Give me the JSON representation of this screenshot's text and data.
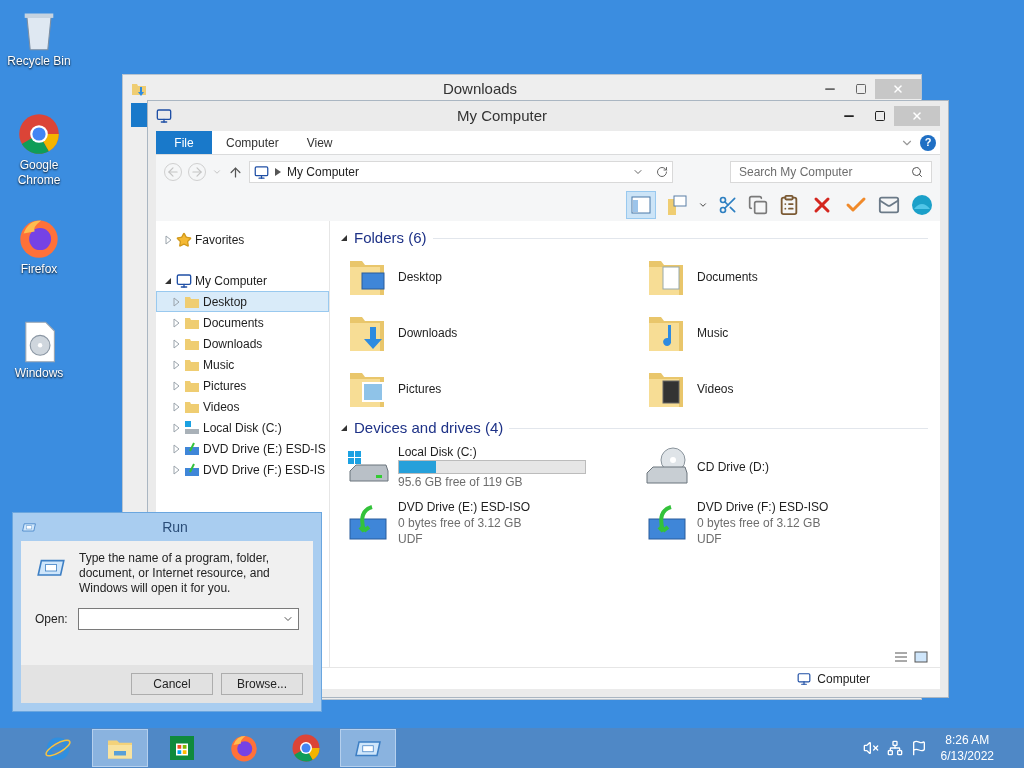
{
  "desktop_icons": [
    {
      "label": "Recycle Bin",
      "kind": "recycle"
    },
    {
      "label": "Google Chrome",
      "kind": "chrome"
    },
    {
      "label": "Firefox",
      "kind": "firefox"
    },
    {
      "label": "Windows",
      "kind": "disc"
    }
  ],
  "back_window": {
    "title": "Downloads"
  },
  "explorer": {
    "title": "My Computer",
    "ribbon_tabs": [
      {
        "label": "File",
        "selected": true
      },
      {
        "label": "Computer",
        "selected": false
      },
      {
        "label": "View",
        "selected": false
      }
    ],
    "address": {
      "path": "My Computer"
    },
    "search": {
      "placeholder": "Search My Computer"
    },
    "nav": [
      {
        "label": "Favorites",
        "kind": "star",
        "expanded": false,
        "selected": false
      },
      {
        "label": "My Computer",
        "kind": "computer",
        "expanded": true,
        "selected": false,
        "children": [
          {
            "label": "Desktop",
            "kind": "folder",
            "expanded": false,
            "selected": true
          },
          {
            "label": "Documents",
            "kind": "folder",
            "expanded": false,
            "selected": false
          },
          {
            "label": "Downloads",
            "kind": "folder",
            "expanded": false,
            "selected": false
          },
          {
            "label": "Music",
            "kind": "folder",
            "expanded": false,
            "selected": false
          },
          {
            "label": "Pictures",
            "kind": "folder",
            "expanded": false,
            "selected": false
          },
          {
            "label": "Videos",
            "kind": "folder",
            "expanded": false,
            "selected": false
          },
          {
            "label": "Local Disk (C:)",
            "kind": "disk",
            "expanded": false,
            "selected": false
          },
          {
            "label": "DVD Drive (E:) ESD-IS",
            "kind": "dvd",
            "expanded": false,
            "selected": false
          },
          {
            "label": "DVD Drive (F:) ESD-IS",
            "kind": "dvd",
            "expanded": false,
            "selected": false
          }
        ]
      }
    ],
    "sections": [
      {
        "title": "Folders (6)",
        "expanded": true,
        "items": [
          {
            "kind": "desktop",
            "name": "Desktop"
          },
          {
            "kind": "documents",
            "name": "Documents"
          },
          {
            "kind": "downloads",
            "name": "Downloads"
          },
          {
            "kind": "music",
            "name": "Music"
          },
          {
            "kind": "pictures",
            "name": "Pictures"
          },
          {
            "kind": "videos",
            "name": "Videos"
          }
        ]
      },
      {
        "title": "Devices and drives (4)",
        "expanded": true,
        "items": [
          {
            "kind": "disk",
            "name": "Local Disk (C:)",
            "level": 0.2,
            "free": "95.6 GB free of 119 GB"
          },
          {
            "kind": "cd",
            "name": "CD Drive (D:)"
          },
          {
            "kind": "dvd",
            "name": "DVD Drive (E:) ESD-ISO",
            "free": "0 bytes free of 3.12 GB",
            "fs": "UDF"
          },
          {
            "kind": "dvd",
            "name": "DVD Drive (F:) ESD-ISO",
            "free": "0 bytes free of 3.12 GB",
            "fs": "UDF"
          }
        ]
      }
    ],
    "help": "?",
    "status": {
      "location": "Computer"
    }
  },
  "run": {
    "title": "Run",
    "description": "Type the name of a program, folder, document, or Internet resource, and Windows will open it for you.",
    "label": "Open:",
    "buttons": [
      "Cancel",
      "Browse..."
    ]
  },
  "taskbar": {
    "apps": [
      {
        "kind": "ie",
        "active": false
      },
      {
        "kind": "explorer",
        "active": true
      },
      {
        "kind": "store",
        "active": false
      },
      {
        "kind": "firefox",
        "active": false
      },
      {
        "kind": "chrome",
        "active": false
      },
      {
        "kind": "run",
        "active": true
      }
    ],
    "time": "8:26 AM",
    "date": "6/13/2022"
  }
}
